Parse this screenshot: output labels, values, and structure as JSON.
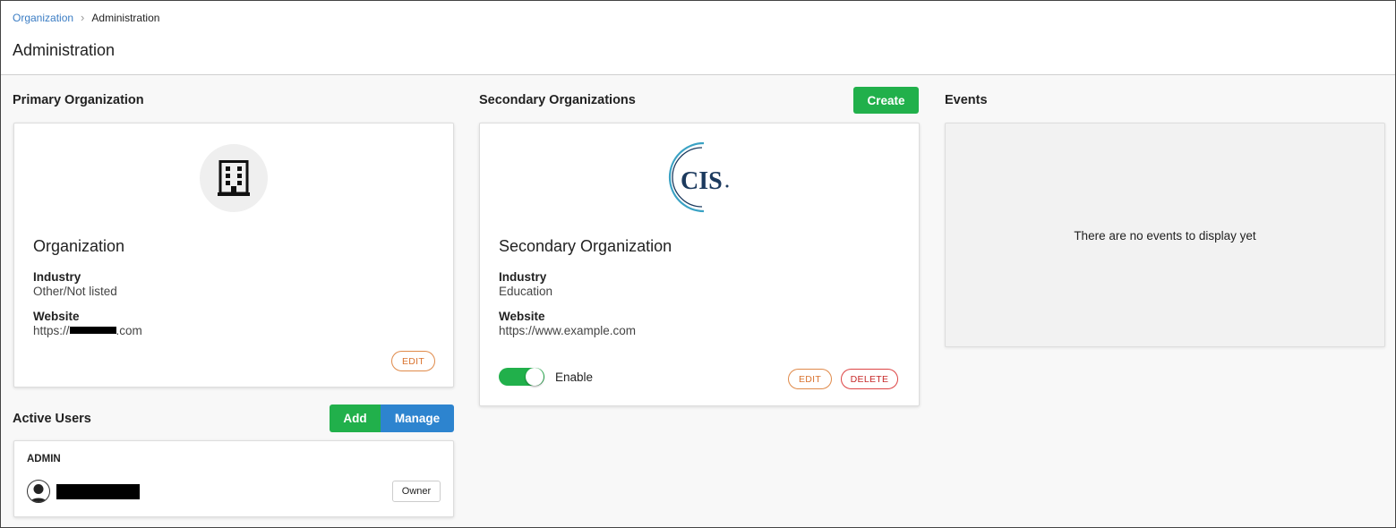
{
  "breadcrumb": {
    "parent": "Organization",
    "current": "Administration"
  },
  "page": {
    "title": "Administration"
  },
  "primary": {
    "section_title": "Primary Organization",
    "name": "Organization",
    "industry_label": "Industry",
    "industry_value": "Other/Not listed",
    "website_label": "Website",
    "website_prefix": "https://",
    "website_suffix": ".com",
    "edit_label": "EDIT",
    "icon": "building-icon"
  },
  "secondary": {
    "section_title": "Secondary Organizations",
    "create_label": "Create",
    "logo_text": "CIS",
    "name": "Secondary Organization",
    "industry_label": "Industry",
    "industry_value": "Education",
    "website_label": "Website",
    "website_value": "https://www.example.com",
    "enable_label": "Enable",
    "enabled": true,
    "edit_label": "EDIT",
    "delete_label": "DELETE"
  },
  "events": {
    "section_title": "Events",
    "empty_message": "There are no events to display yet"
  },
  "users": {
    "section_title": "Active Users",
    "add_label": "Add",
    "manage_label": "Manage",
    "role_heading": "ADMIN",
    "owner_badge": "Owner"
  },
  "colors": {
    "green": "#21b04b",
    "blue": "#2d84cf",
    "edit_orange": "#d9722d",
    "delete_red": "#c62828",
    "link_blue": "#3b7dc4",
    "cis_navy": "#1c3a5e",
    "cis_teal": "#3aa2c4"
  }
}
